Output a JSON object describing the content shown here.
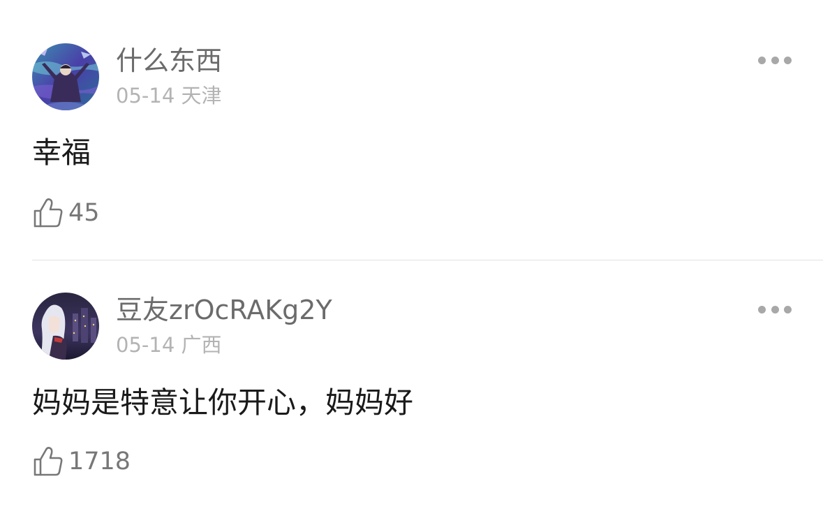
{
  "comments": [
    {
      "username": "什么东西",
      "date": "05-14",
      "location": "天津",
      "text": "幸福",
      "likes": "45",
      "avatar_icon": "avatar-person-raising-arms",
      "more_icon": "more-options-icon"
    },
    {
      "username": "豆友zrOcRAKg2Y",
      "date": "05-14",
      "location": "广西",
      "text": "妈妈是特意让你开心，妈妈好",
      "likes": "1718",
      "avatar_icon": "avatar-anime-girl-night-city",
      "more_icon": "more-options-icon"
    }
  ],
  "colors": {
    "username": "#6b6b6b",
    "meta": "#b3b3b3",
    "body": "#1a1a1a",
    "like": "#777777",
    "divider": "#e2e2e2"
  }
}
